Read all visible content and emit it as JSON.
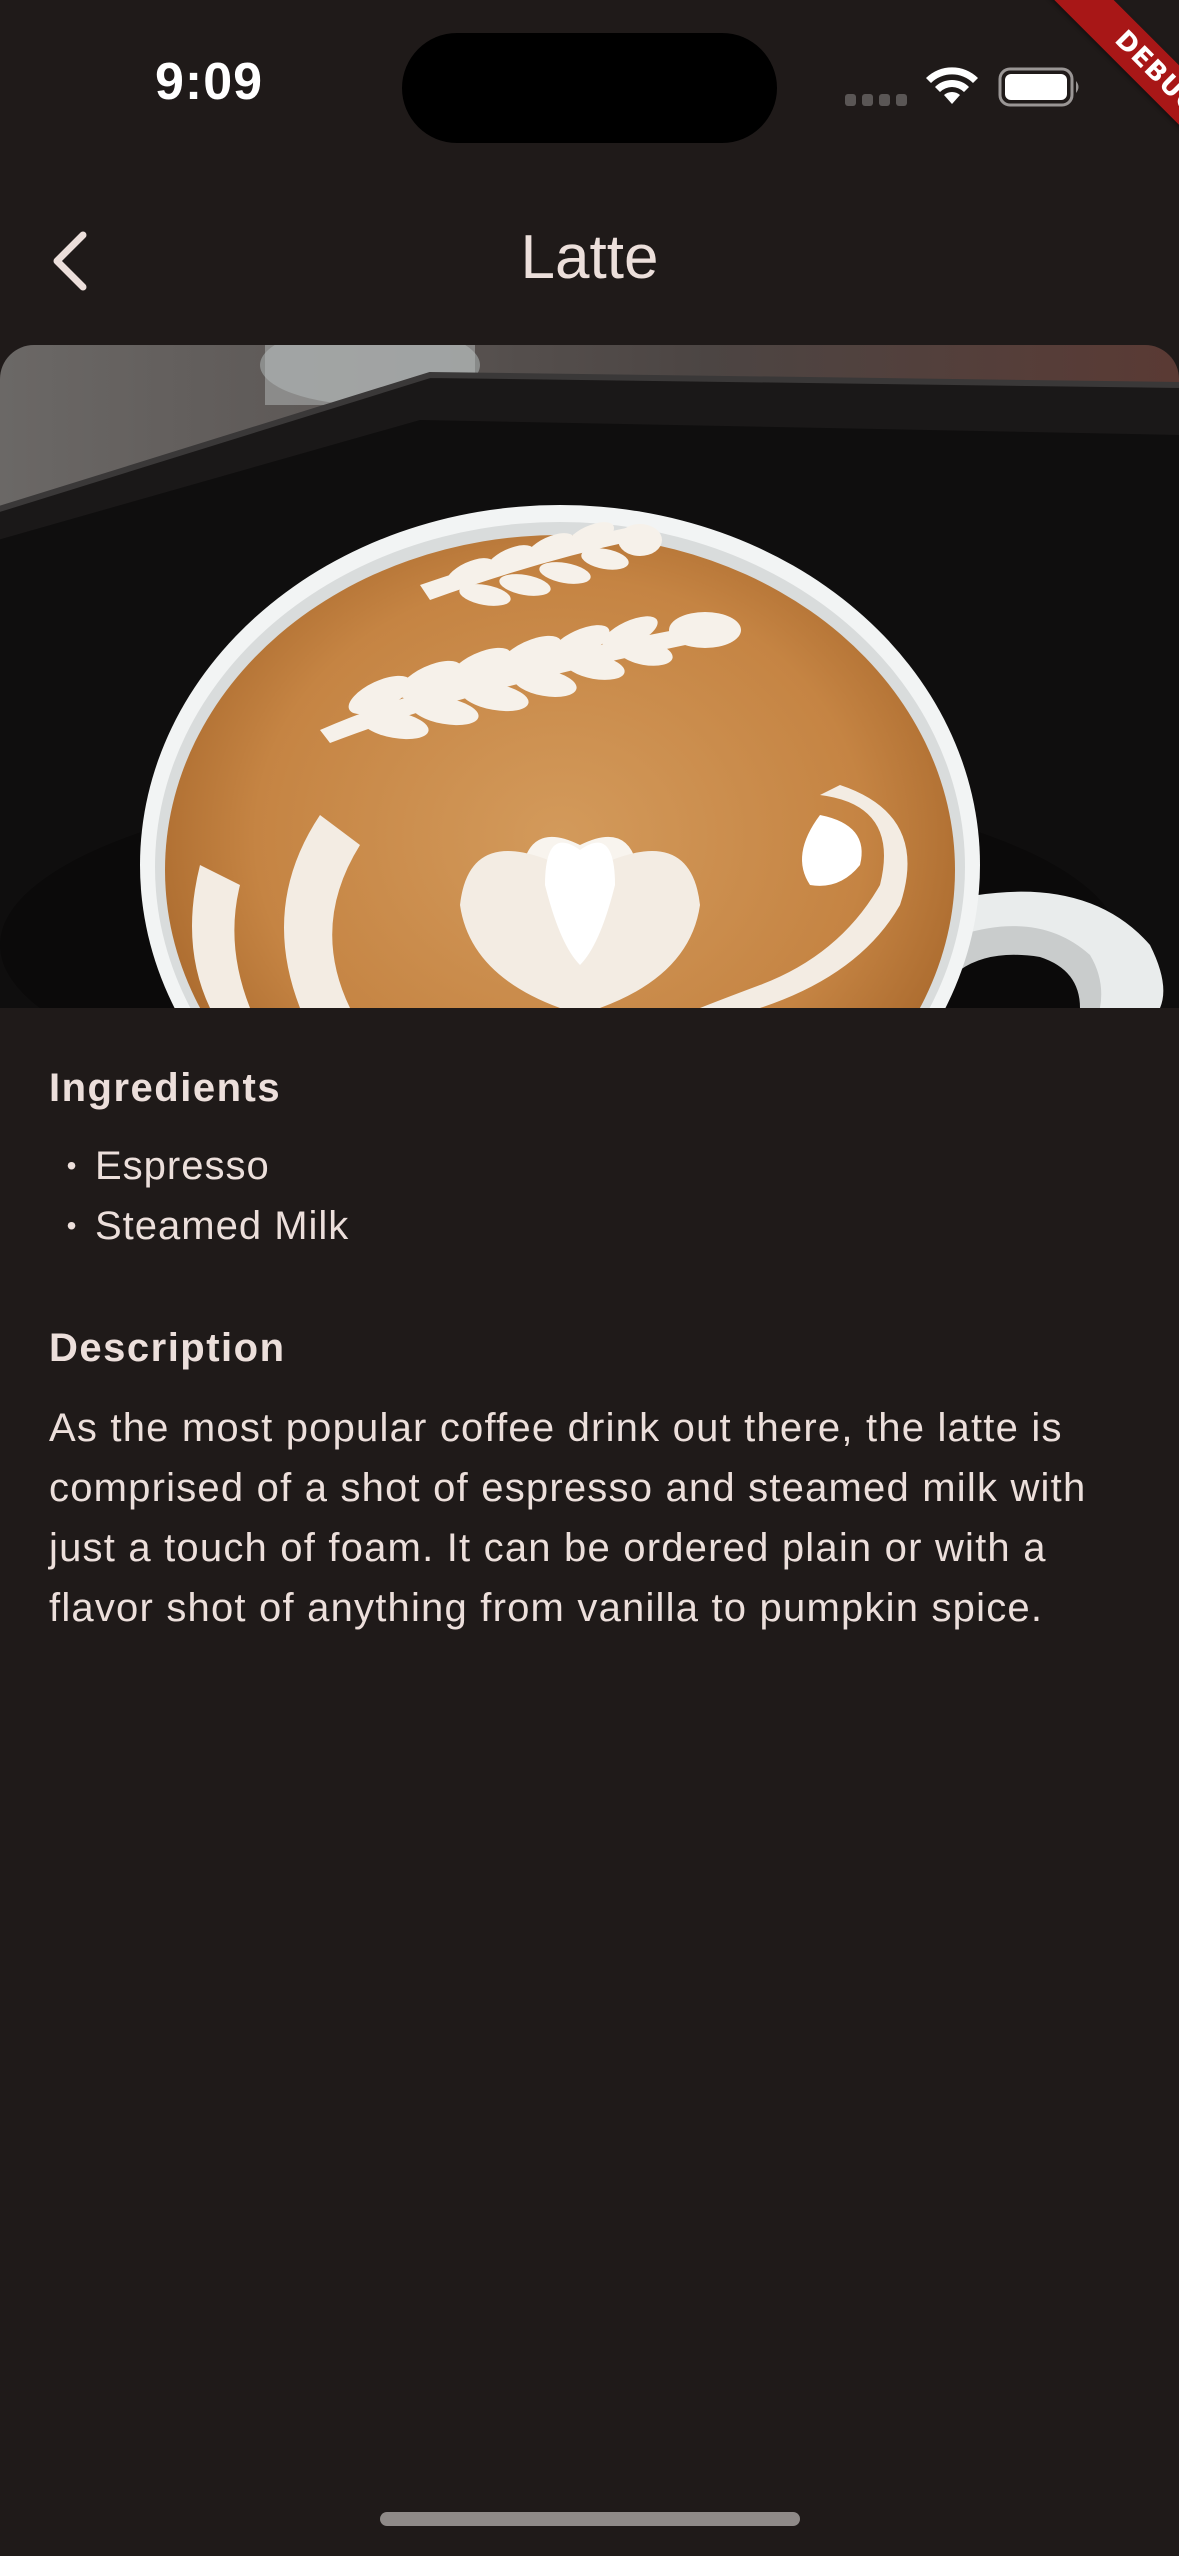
{
  "status_bar": {
    "time": "9:09"
  },
  "debug_banner": {
    "label": "DEBUG"
  },
  "app_bar": {
    "title": "Latte",
    "back_icon": "chevron-left-icon"
  },
  "hero": {
    "subject": "latte-art-image"
  },
  "ingredients": {
    "heading": "Ingredients",
    "bullet": "•",
    "items": [
      "Espresso",
      "Steamed Milk"
    ]
  },
  "description": {
    "heading": "Description",
    "text": "As the most popular coffee drink out there, the latte is comprised of a shot of espresso and steamed milk with just a touch of foam. It can be ordered plain or with a flavor shot of anything from vanilla to pumpkin spice."
  },
  "colors": {
    "background": "#1f1a19",
    "text": "#ecdfdb",
    "debug_banner": "#a81717"
  }
}
